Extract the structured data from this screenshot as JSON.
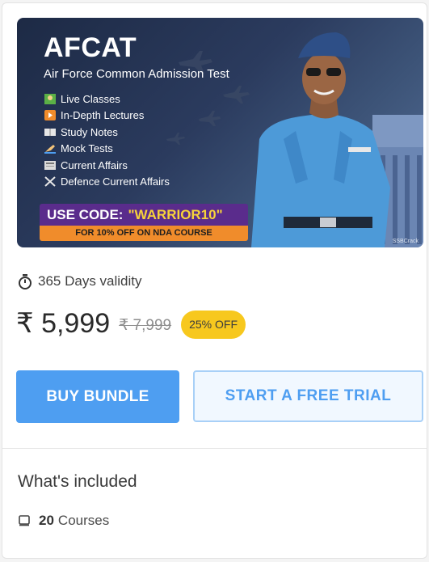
{
  "banner": {
    "title": "AFCAT",
    "subtitle": "Air Force Common Admission Test",
    "features": [
      {
        "icon": "teacher-icon",
        "label": "Live Classes"
      },
      {
        "icon": "play-icon",
        "label": "In-Depth Lectures"
      },
      {
        "icon": "book-icon",
        "label": "Study Notes"
      },
      {
        "icon": "writing-hand-icon",
        "label": "Mock Tests"
      },
      {
        "icon": "newspaper-icon",
        "label": "Current Affairs"
      },
      {
        "icon": "crossed-swords-icon",
        "label": "Defence Current Affairs"
      }
    ],
    "promo_prefix": "USE CODE:",
    "promo_code": "\"WARRIOR10\"",
    "promo_sub": "FOR 10% OFF ON NDA COURSE",
    "watermark": "SSBCrack"
  },
  "validity": "365 Days validity",
  "price": {
    "current": "₹ 5,999",
    "original": "₹ 7,999",
    "discount": "25% OFF"
  },
  "buttons": {
    "buy": "BUY BUNDLE",
    "trial": "START A FREE TRIAL"
  },
  "included": {
    "title": "What's included",
    "count": "20",
    "unit": "Courses"
  },
  "colors": {
    "primary": "#4e9ef1",
    "badge": "#f7c81e",
    "promo_purple": "#5a2c8c",
    "promo_orange": "#f08c2b"
  }
}
